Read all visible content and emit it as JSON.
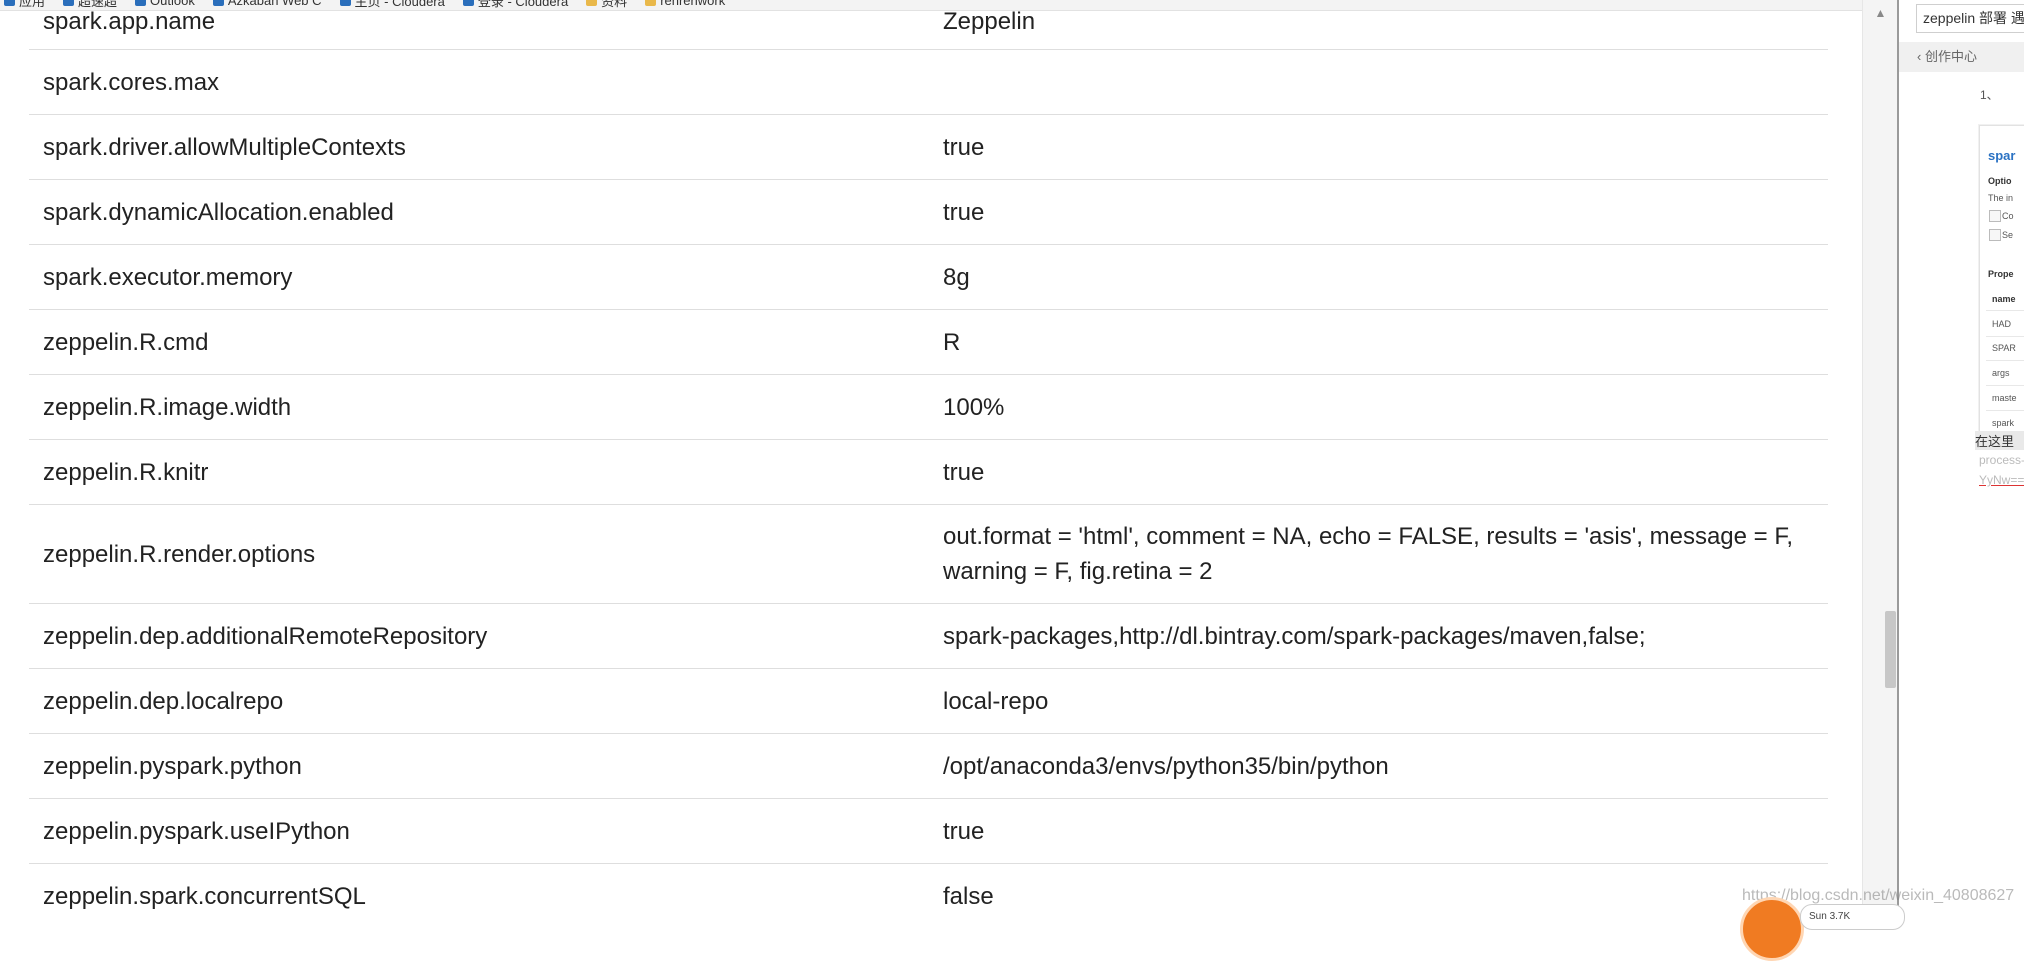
{
  "bookmarks": [
    {
      "label": "应用",
      "icon": "apps-icon"
    },
    {
      "label": "超速超",
      "icon": "bookmark-icon"
    },
    {
      "label": "Outlook",
      "icon": "bookmark-icon"
    },
    {
      "label": "Azkaban Web C",
      "icon": "bookmark-icon"
    },
    {
      "label": "主页 - Cloudera",
      "icon": "bookmark-icon"
    },
    {
      "label": "登录 - Cloudera",
      "icon": "bookmark-icon"
    },
    {
      "label": "资料",
      "icon": "folder-icon"
    },
    {
      "label": "renrenwork",
      "icon": "folder-icon"
    }
  ],
  "properties": [
    {
      "name": "spark.app.name",
      "value": "Zeppelin"
    },
    {
      "name": "spark.cores.max",
      "value": ""
    },
    {
      "name": "spark.driver.allowMultipleContexts",
      "value": "true"
    },
    {
      "name": "spark.dynamicAllocation.enabled",
      "value": "true"
    },
    {
      "name": "spark.executor.memory",
      "value": "8g"
    },
    {
      "name": "zeppelin.R.cmd",
      "value": "R"
    },
    {
      "name": "zeppelin.R.image.width",
      "value": "100%"
    },
    {
      "name": "zeppelin.R.knitr",
      "value": "true"
    },
    {
      "name": "zeppelin.R.render.options",
      "value": "out.format = 'html', comment = NA, echo = FALSE, results = 'asis', message = F, warning = F, fig.retina = 2"
    },
    {
      "name": "zeppelin.dep.additionalRemoteRepository",
      "value": "spark-packages,http://dl.bintray.com/spark-packages/maven,false;"
    },
    {
      "name": "zeppelin.dep.localrepo",
      "value": "local-repo"
    },
    {
      "name": "zeppelin.pyspark.python",
      "value": "/opt/anaconda3/envs/python35/bin/python"
    },
    {
      "name": "zeppelin.pyspark.useIPython",
      "value": "true"
    },
    {
      "name": "zeppelin.spark.concurrentSQL",
      "value": "false"
    }
  ],
  "side": {
    "search_value": "zeppelin 部署 遇",
    "nav_label": "创作中心",
    "list_number": "1、",
    "thumb_title": "spar",
    "thumb_options": "Optio",
    "thumb_text": "The in",
    "thumb_check1": "Co",
    "thumb_check2": "Se",
    "thumb_props": "Prope",
    "thumb_col": "name",
    "thumb_items": [
      "HAD",
      "SPAR",
      "args",
      "maste",
      "spark"
    ],
    "text1": "在这里",
    "text2": "process-",
    "text3": "YyNw=="
  },
  "watermark": "https://blog.csdn.net/weixin_40808627",
  "badge_text": "Sun 3.7K"
}
